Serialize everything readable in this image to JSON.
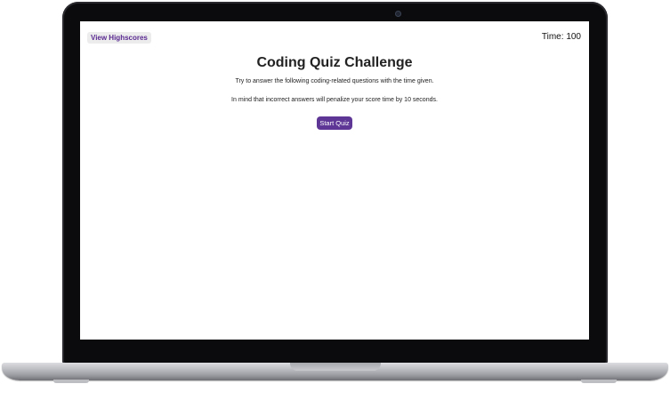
{
  "header": {
    "highscores_label": "View Highscores",
    "timer_label": "Time:",
    "timer_value": "100"
  },
  "main": {
    "title": "Coding Quiz Challenge",
    "instructions_line1": "Try to answer the following coding-related questions with the time given.",
    "instructions_line2": "In mind that incorrect answers will penalize your score time by 10 seconds.",
    "start_button_label": "Start Quiz"
  },
  "colors": {
    "accent": "#5e3796",
    "link": "#5a2a91",
    "text": "#222222"
  }
}
